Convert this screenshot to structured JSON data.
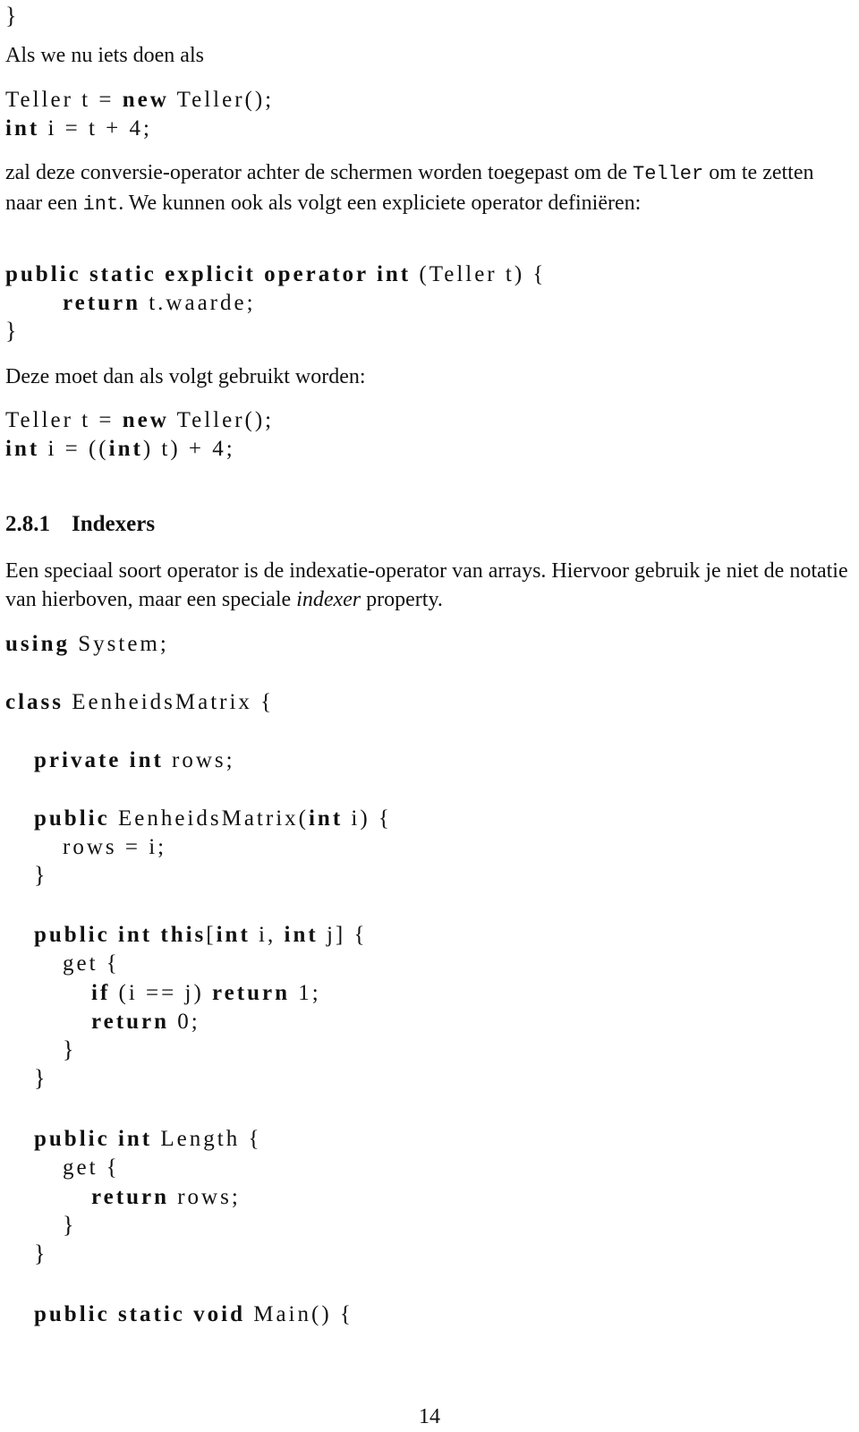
{
  "top_brace": "}",
  "p1": "Als we nu iets doen als",
  "code1": {
    "l1": {
      "a": "Teller t = ",
      "kw": "new",
      "b": " Teller();"
    },
    "l2": {
      "kw": "int",
      "b": " i = t + 4;"
    }
  },
  "p2": {
    "a": "zal deze conversie-operator achter de schermen worden toegepast om de ",
    "tt1": "Teller",
    "b": " om te zetten naar een ",
    "tt2": "int",
    "c": ". We kunnen ook als volgt een expliciete operator definiëren:"
  },
  "code2": {
    "l1": {
      "kw": "public static explicit operator int",
      "b": " (Teller t) {"
    },
    "l2": {
      "kw": "return",
      "b": " t.waarde;"
    },
    "l3": "}"
  },
  "p3": "Deze moet dan als volgt gebruikt worden:",
  "code3": {
    "l1": {
      "a": "Teller t = ",
      "kw": "new",
      "b": " Teller();"
    },
    "l2": {
      "kw1": "int",
      "a": " i = ((",
      "kw2": "int",
      "b": ") t) + 4;"
    }
  },
  "section": {
    "number": "2.8.1",
    "title": "Indexers"
  },
  "p4": {
    "a": "Een speciaal soort operator is de indexatie-operator van arrays. Hiervoor gebruik je niet de notatie van hierboven, maar een speciale ",
    "em": "indexer",
    "b": " property."
  },
  "code4": {
    "using": {
      "kw": "using",
      "b": " System;"
    },
    "class": {
      "kw": "class",
      "b": " EenheidsMatrix {"
    },
    "field": {
      "kw": "private int",
      "b": " rows;"
    },
    "ctor": {
      "kw1": "public",
      "a": " EenheidsMatrix(",
      "kw2": "int",
      "b": " i) {"
    },
    "ctor_body": "rows = i;",
    "ctor_close": "}",
    "indexer": {
      "kw1": "public int this",
      "a": "[",
      "kw2": "int",
      "b": " i, ",
      "kw3": "int",
      "c": " j] {"
    },
    "get1": "get {",
    "if_line": {
      "kw1": "if",
      "a": " (i == j) ",
      "kw2": "return",
      "b": " 1;"
    },
    "ret0": {
      "kw": "return",
      "b": " 0;"
    },
    "get1_close": "}",
    "indexer_close": "}",
    "length": {
      "kw": "public int",
      "b": " Length {"
    },
    "get2": "get {",
    "ret_rows": {
      "kw": "return",
      "b": " rows;"
    },
    "get2_close": "}",
    "length_close": "}",
    "main": {
      "kw": "public static void",
      "b": " Main() {"
    }
  },
  "page_number": "14"
}
